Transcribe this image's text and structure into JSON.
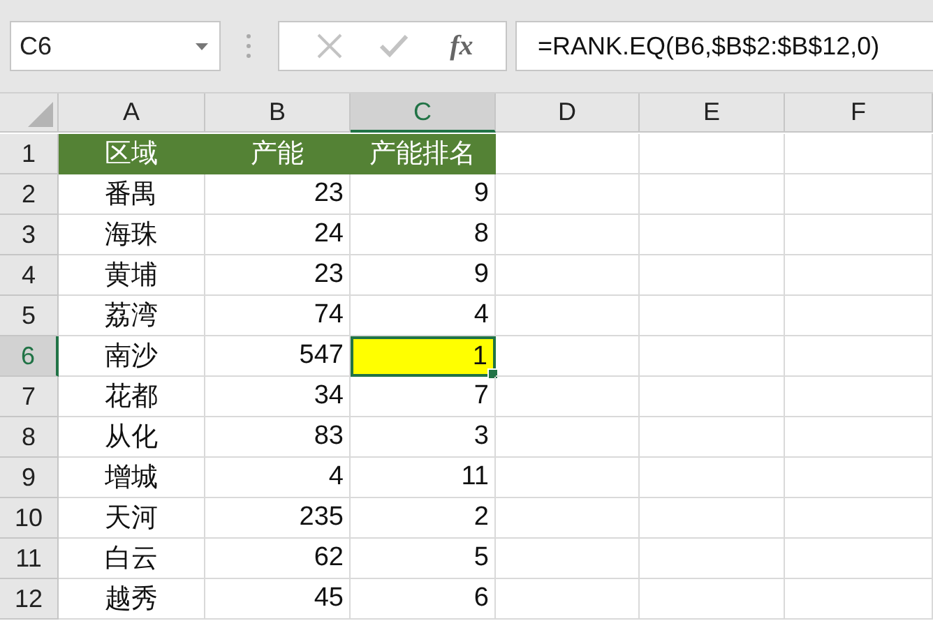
{
  "name_box": "C6",
  "formula_bar": {
    "function_label": "fx",
    "formula": "=RANK.EQ(B6,$B$2:$B$12,0)"
  },
  "columns": [
    {
      "label": "A",
      "selected": false
    },
    {
      "label": "B",
      "selected": false
    },
    {
      "label": "C",
      "selected": true
    },
    {
      "label": "D",
      "selected": false
    },
    {
      "label": "E",
      "selected": false
    },
    {
      "label": "F",
      "selected": false
    }
  ],
  "rows": [
    {
      "number": "1",
      "selected": false,
      "kind": "header",
      "cells": [
        {
          "text": "区域",
          "selected": false
        },
        {
          "text": "产能",
          "selected": false
        },
        {
          "text": "产能排名",
          "selected": false
        }
      ]
    },
    {
      "number": "2",
      "selected": false,
      "kind": "data",
      "cells": [
        {
          "text": "番禺",
          "selected": false
        },
        {
          "text": "23",
          "selected": false
        },
        {
          "text": "9",
          "selected": false
        }
      ]
    },
    {
      "number": "3",
      "selected": false,
      "kind": "data",
      "cells": [
        {
          "text": "海珠",
          "selected": false
        },
        {
          "text": "24",
          "selected": false
        },
        {
          "text": "8",
          "selected": false
        }
      ]
    },
    {
      "number": "4",
      "selected": false,
      "kind": "data",
      "cells": [
        {
          "text": "黄埔",
          "selected": false
        },
        {
          "text": "23",
          "selected": false
        },
        {
          "text": "9",
          "selected": false
        }
      ]
    },
    {
      "number": "5",
      "selected": false,
      "kind": "data",
      "cells": [
        {
          "text": "荔湾",
          "selected": false
        },
        {
          "text": "74",
          "selected": false
        },
        {
          "text": "4",
          "selected": false
        }
      ]
    },
    {
      "number": "6",
      "selected": true,
      "kind": "data",
      "cells": [
        {
          "text": "南沙",
          "selected": false
        },
        {
          "text": "547",
          "selected": false
        },
        {
          "text": "1",
          "selected": true
        }
      ]
    },
    {
      "number": "7",
      "selected": false,
      "kind": "data",
      "cells": [
        {
          "text": "花都",
          "selected": false
        },
        {
          "text": "34",
          "selected": false
        },
        {
          "text": "7",
          "selected": false
        }
      ]
    },
    {
      "number": "8",
      "selected": false,
      "kind": "data",
      "cells": [
        {
          "text": "从化",
          "selected": false
        },
        {
          "text": "83",
          "selected": false
        },
        {
          "text": "3",
          "selected": false
        }
      ]
    },
    {
      "number": "9",
      "selected": false,
      "kind": "data",
      "cells": [
        {
          "text": "增城",
          "selected": false
        },
        {
          "text": "4",
          "selected": false
        },
        {
          "text": "11",
          "selected": false
        }
      ]
    },
    {
      "number": "10",
      "selected": false,
      "kind": "data",
      "cells": [
        {
          "text": "天河",
          "selected": false
        },
        {
          "text": "235",
          "selected": false
        },
        {
          "text": "2",
          "selected": false
        }
      ]
    },
    {
      "number": "11",
      "selected": false,
      "kind": "data",
      "cells": [
        {
          "text": "白云",
          "selected": false
        },
        {
          "text": "62",
          "selected": false
        },
        {
          "text": "5",
          "selected": false
        }
      ]
    },
    {
      "number": "12",
      "selected": false,
      "kind": "data",
      "cells": [
        {
          "text": "越秀",
          "selected": false
        },
        {
          "text": "45",
          "selected": false
        },
        {
          "text": "6",
          "selected": false
        }
      ]
    }
  ]
}
